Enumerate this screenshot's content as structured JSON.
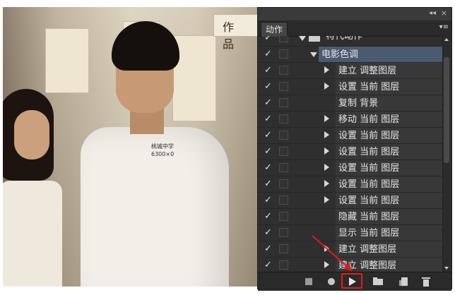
{
  "photo": {
    "sign_text": "作 品",
    "badge_text": "桃城中学\n6300×0"
  },
  "panel": {
    "tab_label": "动作",
    "collapse_label": "◂◂",
    "close_label": "×",
    "menu_label": "▾≡"
  },
  "rows": [
    {
      "label": "特代动作",
      "type": "set"
    },
    {
      "label": "电影色调",
      "type": "action"
    },
    {
      "label": "建立 调整图层",
      "type": "step"
    },
    {
      "label": "设置 当前 图层",
      "type": "step"
    },
    {
      "label": "复制 背景",
      "type": "step_plain"
    },
    {
      "label": "移动 当前 图层",
      "type": "step"
    },
    {
      "label": "设置 当前 图层",
      "type": "step"
    },
    {
      "label": "设置 当前 图层",
      "type": "step"
    },
    {
      "label": "设置 当前 图层",
      "type": "step"
    },
    {
      "label": "设置 当前 图层",
      "type": "step"
    },
    {
      "label": "设置 当前 图层",
      "type": "step"
    },
    {
      "label": "隐藏 当前 图层",
      "type": "step_plain"
    },
    {
      "label": "显示 当前 图层",
      "type": "step_plain"
    },
    {
      "label": "建立 调整图层",
      "type": "step"
    },
    {
      "label": "建立 调整图层",
      "type": "step"
    }
  ],
  "toolbar": {
    "stop": "stop-playing-icon",
    "record": "record-icon",
    "play": "play-selection-icon",
    "new_set": "folder-icon",
    "new_action": "new-action-icon",
    "delete": "trash-icon"
  },
  "colors": {
    "highlight_box": "#e21b1b",
    "selected_row": "#4a5a70",
    "panel_bg": "#2f2f2f"
  }
}
